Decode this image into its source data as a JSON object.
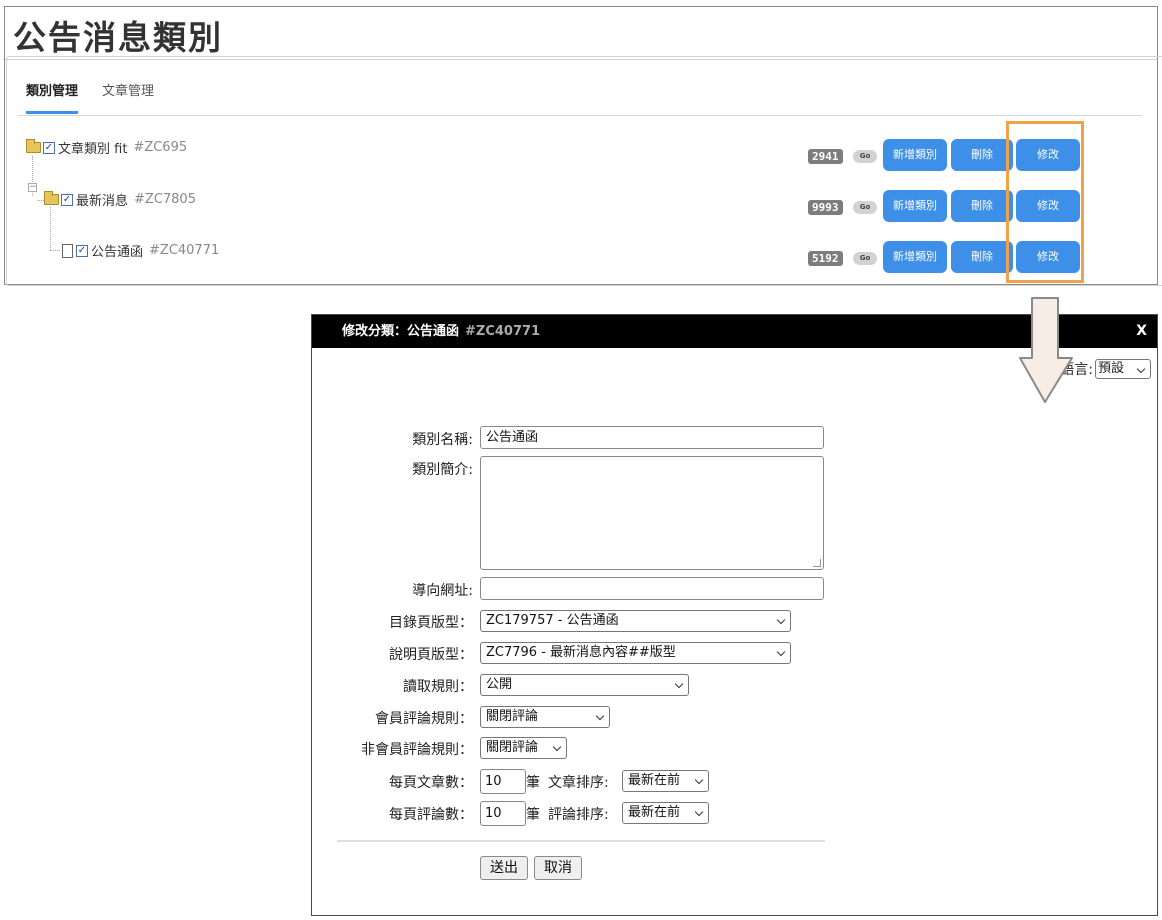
{
  "page": {
    "title": "公告消息類別"
  },
  "tabs": [
    {
      "label": "類別管理"
    },
    {
      "label": "文章管理"
    }
  ],
  "tree": [
    {
      "label": "文章類別 fit",
      "code": "#ZC695",
      "count": "2941"
    },
    {
      "label": "最新消息",
      "code": "#ZC7805",
      "count": "9993"
    },
    {
      "label": "公告通函",
      "code": "#ZC40771",
      "count": "5192"
    }
  ],
  "row_actions": {
    "go_label": "Go",
    "add_label": "新增類別",
    "delete_label": "刪除",
    "edit_label": "修改"
  },
  "modal": {
    "title": "修改分類：公告通函",
    "title_code": "#ZC40771",
    "close_label": "X",
    "lang_label": "語言:",
    "lang_value": "預設",
    "fields": {
      "name_label": "類別名稱:",
      "name_value": "公告通函",
      "intro_label": "類別簡介:",
      "url_label": "導向網址:",
      "url_value": "",
      "list_template_label": "目錄頁版型：",
      "list_template_value": "ZC179757 - 公告通函",
      "desc_template_label": "說明頁版型：",
      "desc_template_value": "ZC7796 - 最新消息內容##版型",
      "read_rule_label": "讀取規則：",
      "read_rule_value": "公開",
      "member_comment_label": "會員評論規則：",
      "member_comment_value": "關閉評論",
      "nonmember_comment_label": "非會員評論規則：",
      "nonmember_comment_value": "關閉評論",
      "articles_per_page_label": "每頁文章數：",
      "articles_per_page_value": "10",
      "articles_unit": "筆",
      "article_sort_label": "文章排序:",
      "article_sort_value": "最新在前",
      "comments_per_page_label": "每頁評論數：",
      "comments_per_page_value": "10",
      "comments_unit": "筆",
      "comment_sort_label": "評論排序:",
      "comment_sort_value": "最新在前"
    },
    "submit_label": "送出",
    "cancel_label": "取消"
  },
  "colors": {
    "button_blue": "#3d8fe8",
    "highlight_orange": "#f0a24a",
    "header_black": "#000000"
  }
}
